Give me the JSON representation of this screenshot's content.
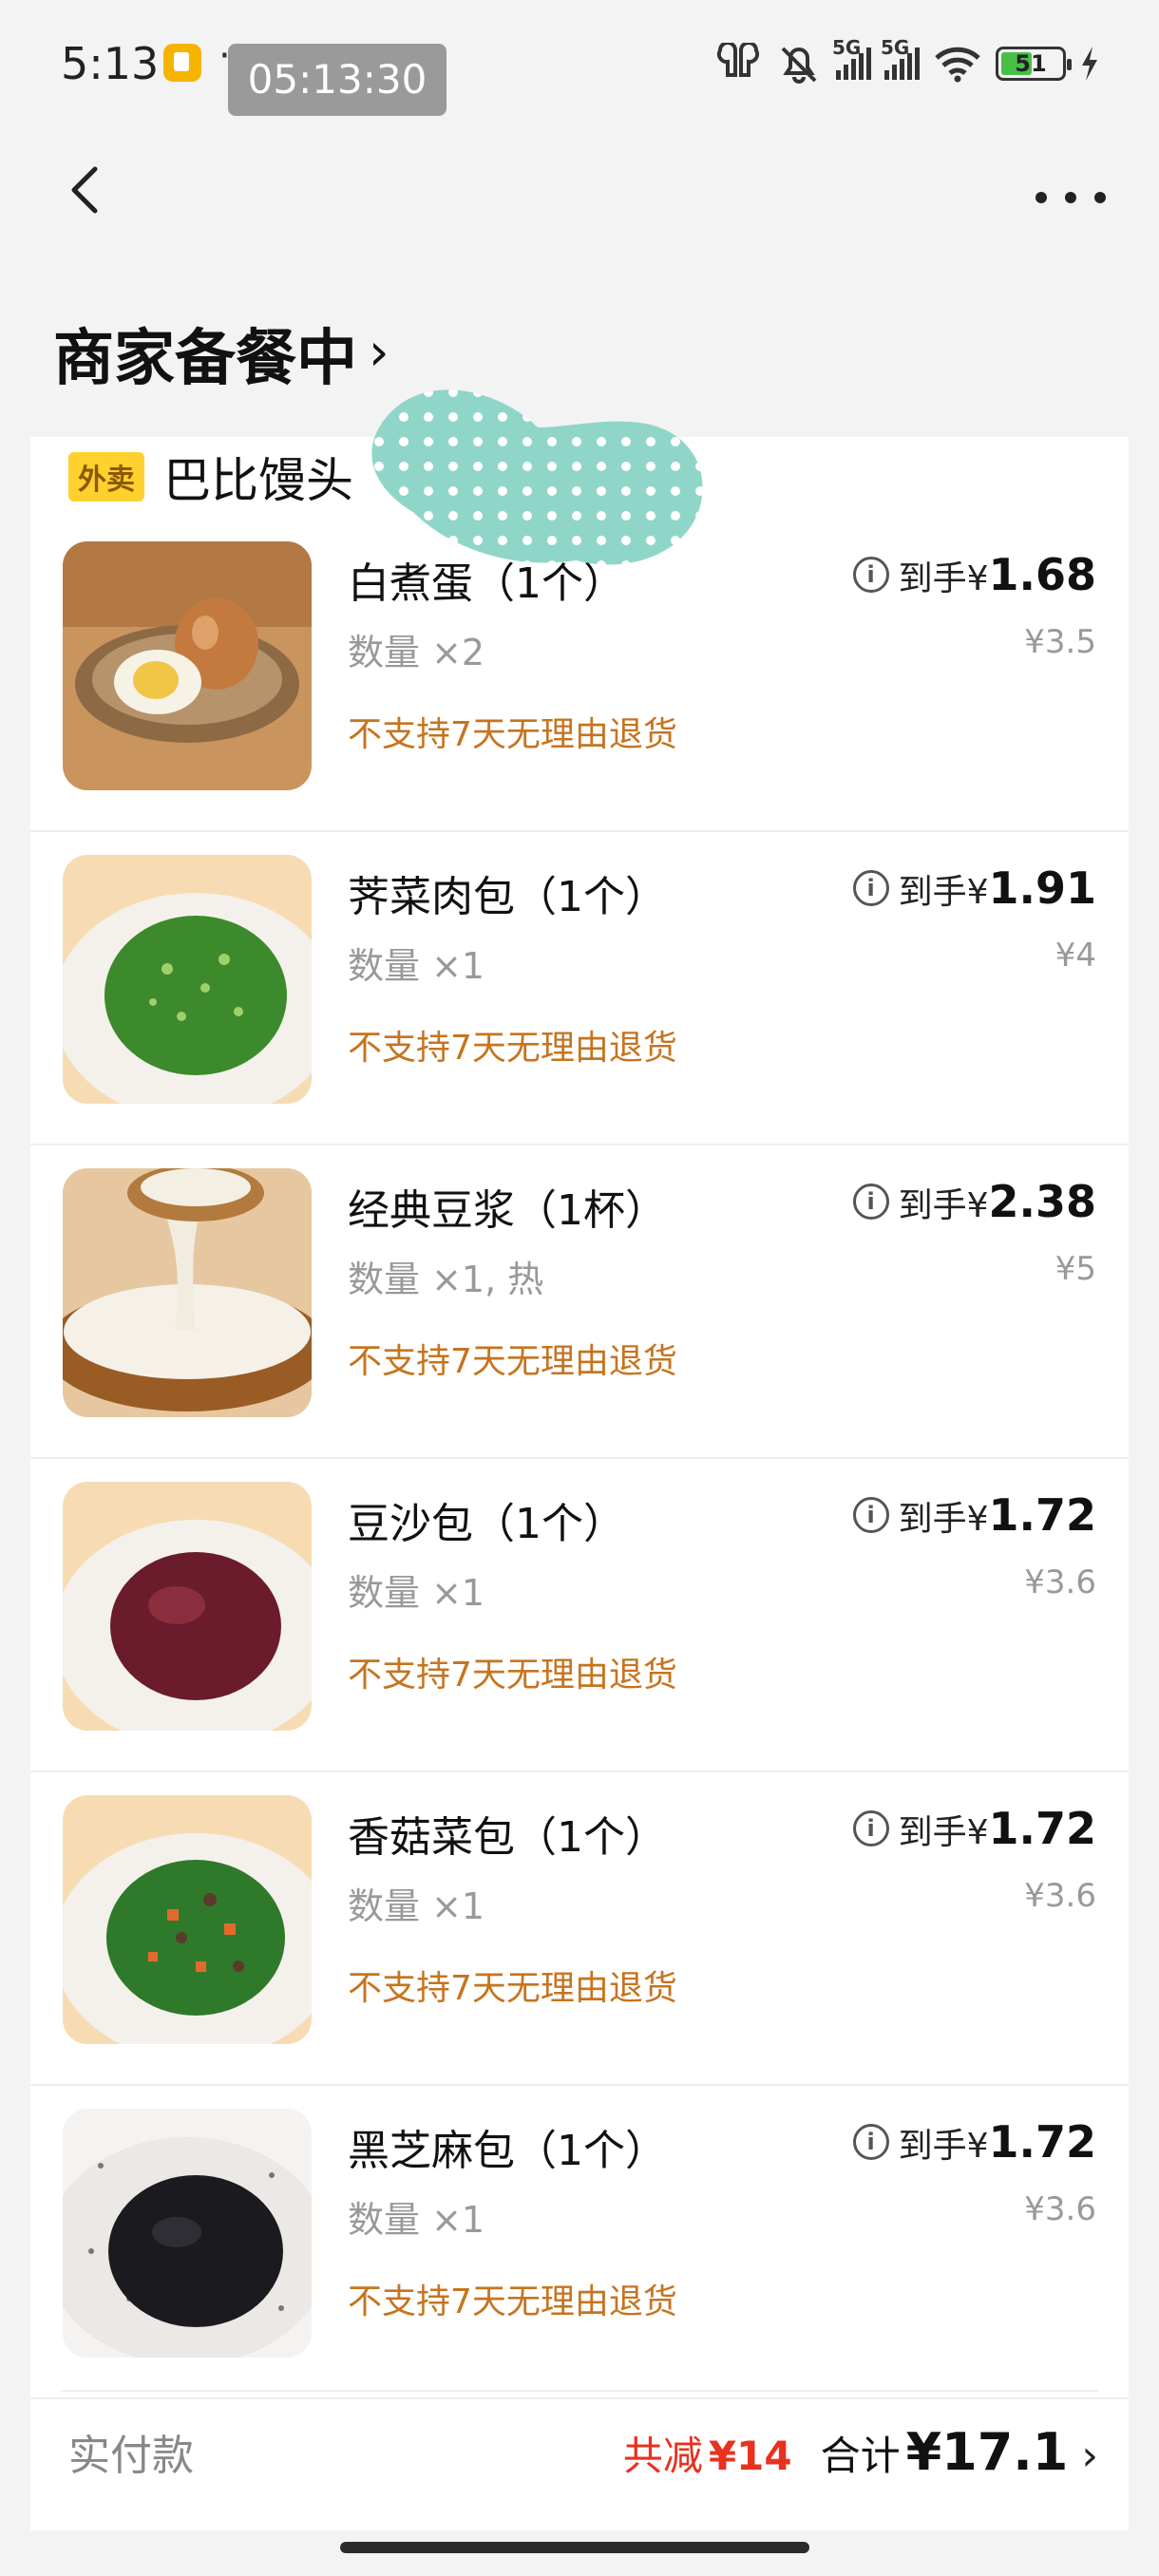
{
  "status_bar": {
    "time": "5:13",
    "dots": "···",
    "overlay_time": "05:13:30",
    "battery": "51",
    "battery_level": 0.51,
    "net1": "5G",
    "net2": "5G"
  },
  "header": {
    "title": "商家备餐中",
    "chevron": "›"
  },
  "shop": {
    "badge": "外卖",
    "name": "巴比馒头"
  },
  "items": [
    {
      "name": "白煮蛋（1个）",
      "qty": "数量 ×2",
      "policy": "不支持7天无理由退货",
      "price_label": "到手¥",
      "price": "1.68",
      "original": "¥3.5",
      "image": "boiled-egg"
    },
    {
      "name": "荠菜肉包（1个）",
      "qty": "数量 ×1",
      "policy": "不支持7天无理由退货",
      "price_label": "到手¥",
      "price": "1.91",
      "original": "¥4",
      "image": "shepherd-purse-bun"
    },
    {
      "name": "经典豆浆（1杯）",
      "qty": "数量 ×1, 热",
      "policy": "不支持7天无理由退货",
      "price_label": "到手¥",
      "price": "2.38",
      "original": "¥5",
      "image": "soy-milk"
    },
    {
      "name": "豆沙包（1个）",
      "qty": "数量 ×1",
      "policy": "不支持7天无理由退货",
      "price_label": "到手¥",
      "price": "1.72",
      "original": "¥3.6",
      "image": "red-bean-bun"
    },
    {
      "name": "香菇菜包（1个）",
      "qty": "数量 ×1",
      "policy": "不支持7天无理由退货",
      "price_label": "到手¥",
      "price": "1.72",
      "original": "¥3.6",
      "image": "mushroom-veg-bun"
    },
    {
      "name": "黑芝麻包（1个）",
      "qty": "数量 ×1",
      "policy": "不支持7天无理由退货",
      "price_label": "到手¥",
      "price": "1.72",
      "original": "¥3.6",
      "image": "black-sesame-bun"
    }
  ],
  "info_icon_glyph": "i",
  "footer": {
    "paid_label": "实付款",
    "discount_label": "共减",
    "discount_value": "¥14",
    "total_label": "合计",
    "total_value": "¥17.1",
    "chevron": "›"
  },
  "colors": {
    "policy": "#c6741f",
    "discount": "#e8311e",
    "badge": "#ffd12e",
    "blob": "#8fd6c9"
  }
}
